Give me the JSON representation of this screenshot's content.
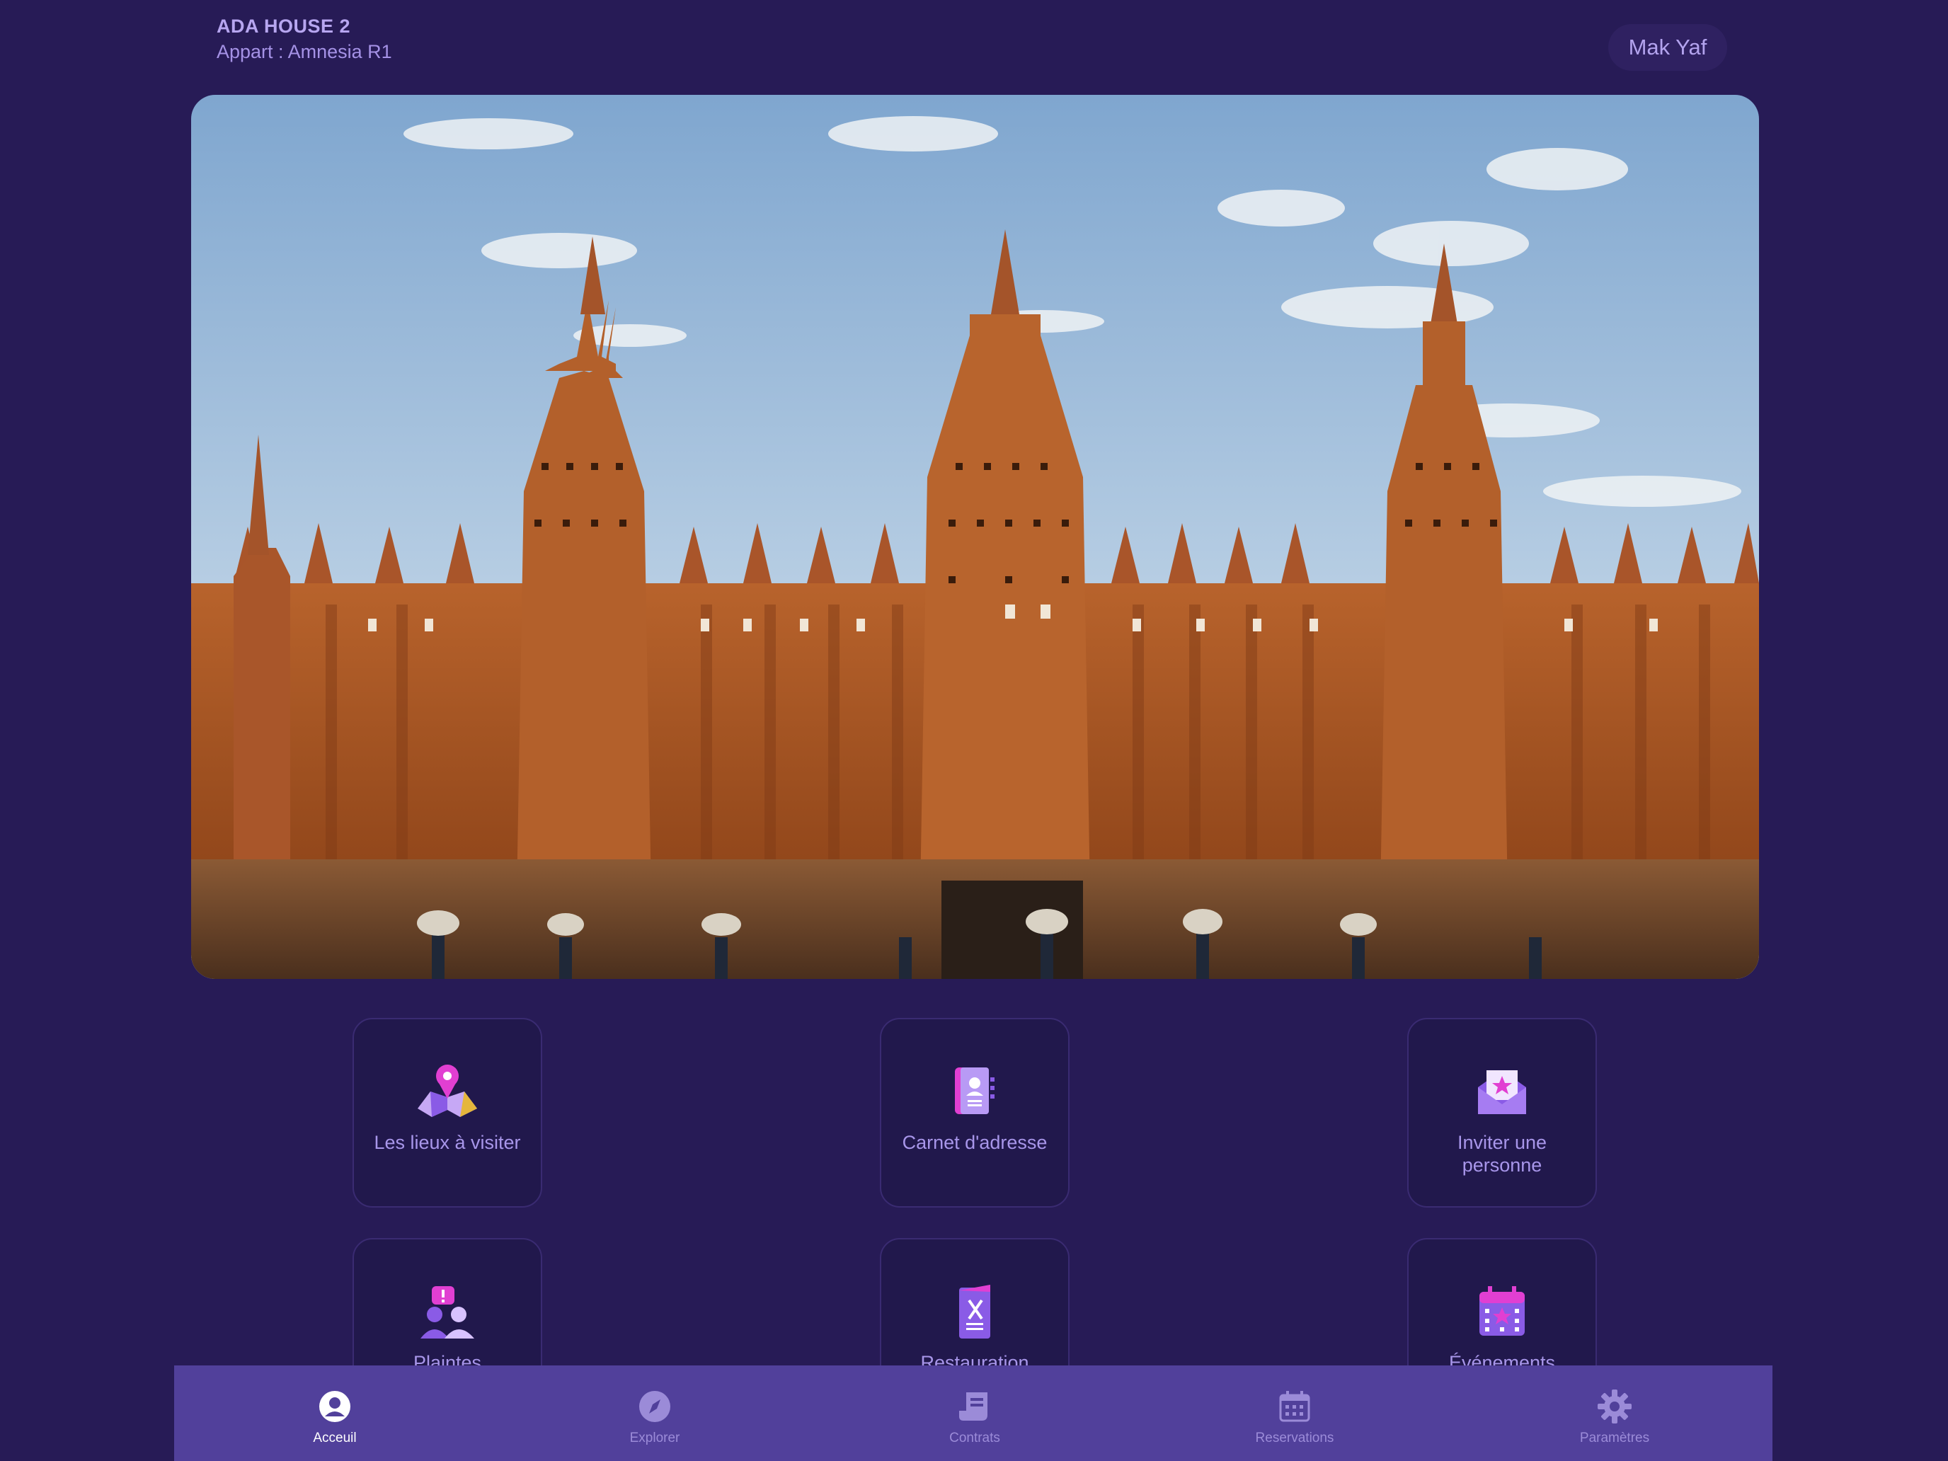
{
  "header": {
    "title": "ADA HOUSE 2",
    "subtitle": "Appart : Amnesia R1",
    "user_name": "Mak Yaf"
  },
  "tiles": [
    {
      "label": "Les lieux à visiter",
      "icon": "map-pin-icon"
    },
    {
      "label": "Carnet d'adresse",
      "icon": "address-book-icon"
    },
    {
      "label": "Inviter une personne",
      "icon": "invite-envelope-icon"
    },
    {
      "label": "Plaintes",
      "icon": "complaint-people-icon"
    },
    {
      "label": "Restauration",
      "icon": "restaurant-menu-icon"
    },
    {
      "label": "Événements",
      "icon": "calendar-event-icon"
    }
  ],
  "nav": [
    {
      "label": "Acceuil",
      "icon": "user-circle-icon",
      "active": true
    },
    {
      "label": "Explorer",
      "icon": "compass-icon",
      "active": false
    },
    {
      "label": "Contrats",
      "icon": "contract-scroll-icon",
      "active": false
    },
    {
      "label": "Reservations",
      "icon": "calendar-icon",
      "active": false
    },
    {
      "label": "Paramètres",
      "icon": "gear-icon",
      "active": false
    }
  ],
  "colors": {
    "background": "#271b56",
    "nav_background": "#51409b",
    "accent_pink": "#e13fd2",
    "accent_purple": "#8a5be6"
  }
}
